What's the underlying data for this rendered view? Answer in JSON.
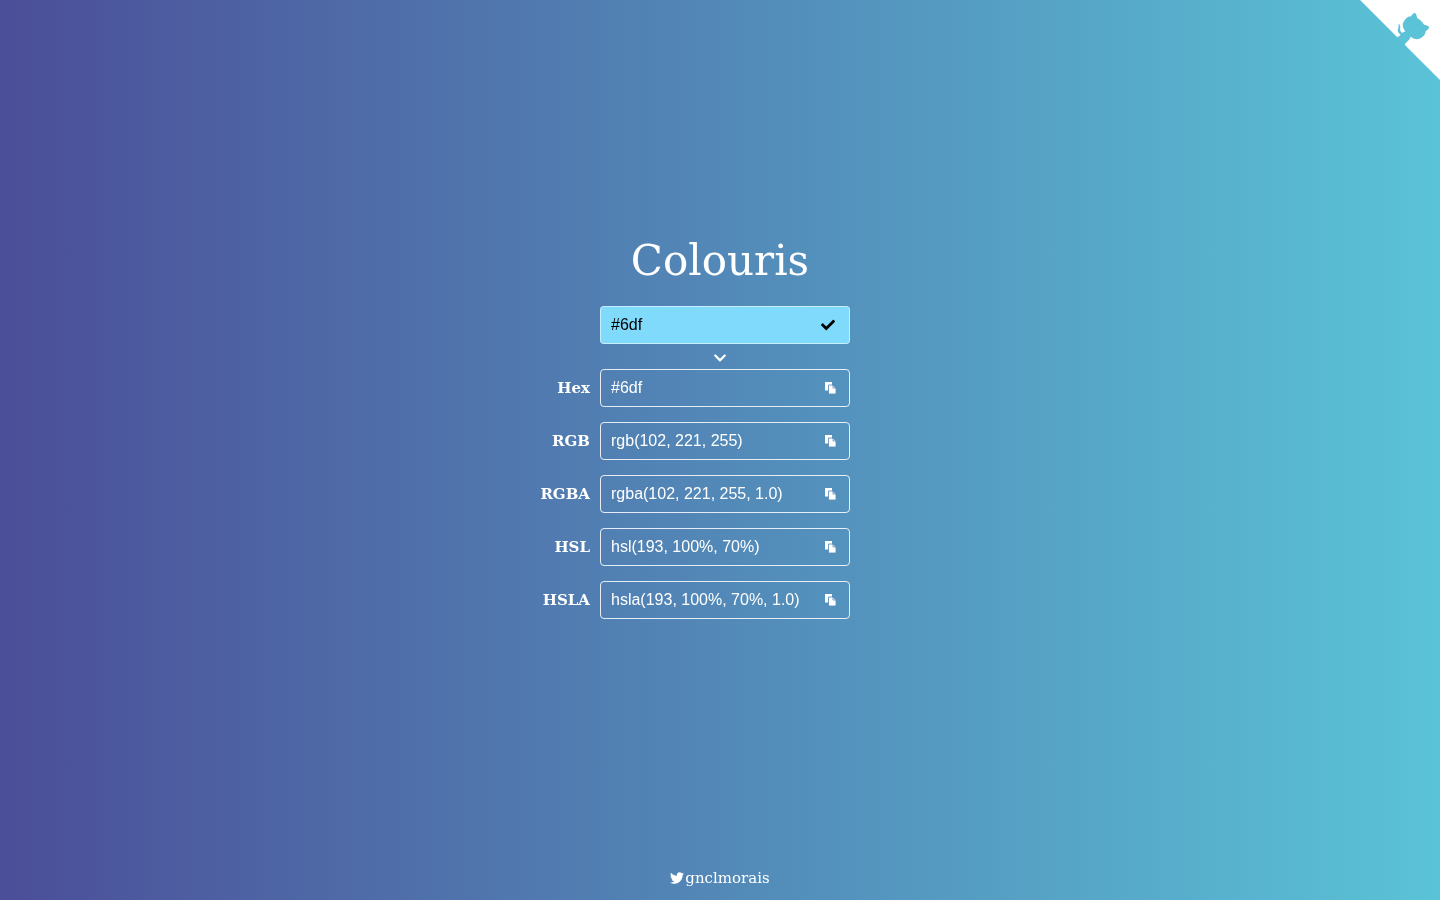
{
  "title": "Colouris",
  "color_input": {
    "value": "#6df",
    "valid": true
  },
  "formats": [
    {
      "label": "Hex",
      "value": "#6df"
    },
    {
      "label": "RGB",
      "value": "rgb(102, 221, 255)"
    },
    {
      "label": "RGBA",
      "value": "rgba(102, 221, 255, 1.0)"
    },
    {
      "label": "HSL",
      "value": "hsl(193, 100%, 70%)"
    },
    {
      "label": "HSLA",
      "value": "hsla(193, 100%, 70%, 1.0)"
    }
  ],
  "footer": {
    "handle": "gnclmorais"
  }
}
